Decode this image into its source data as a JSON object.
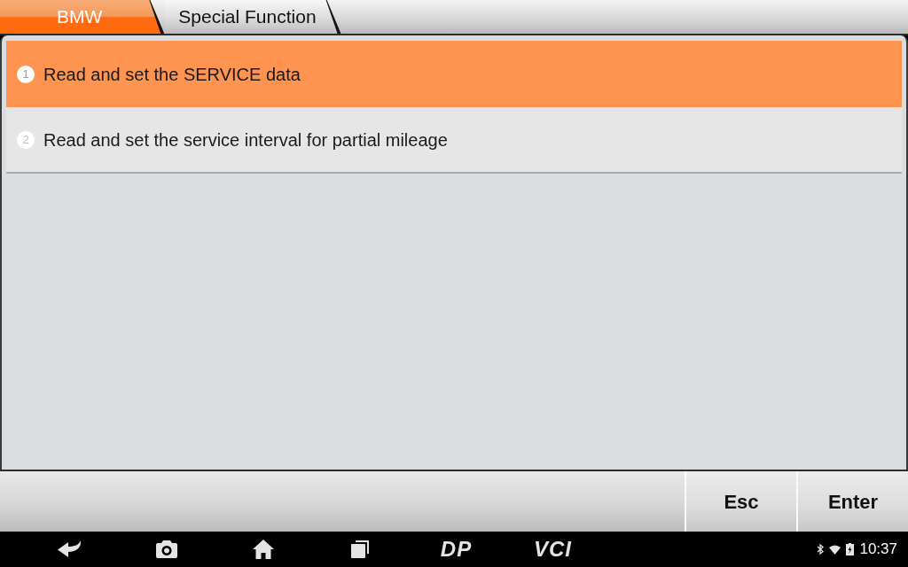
{
  "breadcrumbs": [
    {
      "label": "BMW",
      "selected": true
    },
    {
      "label": "Special Function",
      "selected": false
    }
  ],
  "menu_items": [
    {
      "number": "1",
      "label": "Read and set the SERVICE data",
      "selected": true
    },
    {
      "number": "2",
      "label": "Read and set the service interval for partial mileage",
      "selected": false
    }
  ],
  "buttons": [
    "Esc",
    "Enter"
  ],
  "nav_shortcuts": [
    "DP",
    "VCI"
  ],
  "status_bar": {
    "time": "10:37"
  }
}
